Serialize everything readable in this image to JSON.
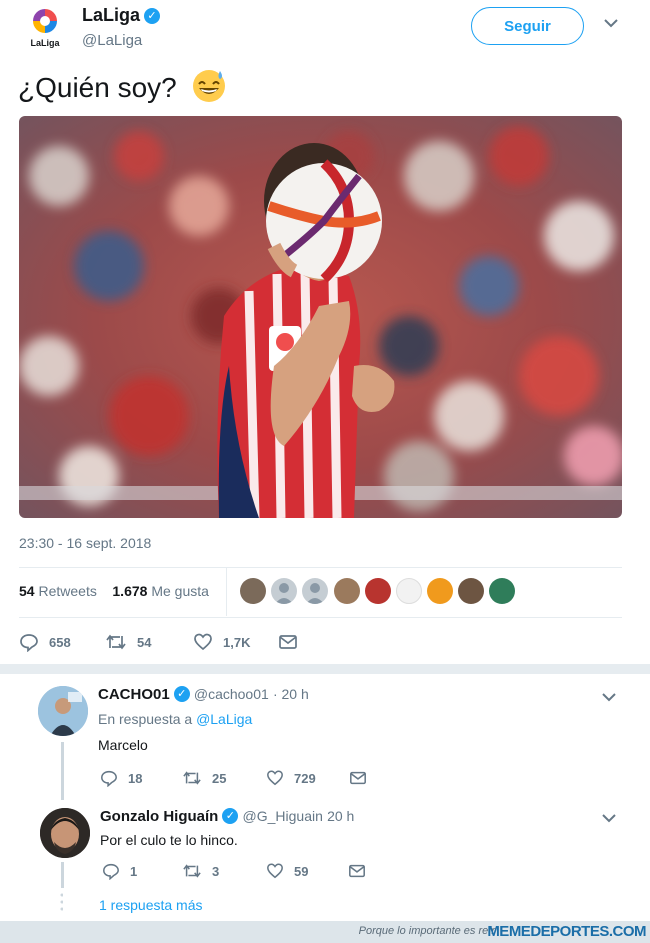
{
  "tweet": {
    "name": "LaLiga",
    "handle": "@LaLiga",
    "logo_text": "LaLiga",
    "follow_label": "Seguir",
    "text": "¿Quién soy?",
    "timestamp": "23:30 - 16 sept. 2018",
    "retweets_count": "54",
    "retweets_label": "Retweets",
    "likes_count": "1.678",
    "likes_label": "Me gusta",
    "actions": {
      "replies": "658",
      "retweets": "54",
      "likes": "1,7K"
    }
  },
  "replies": [
    {
      "name": "CACHO01",
      "handle": "@cachoo01",
      "time": "· 20 h",
      "reply_to_label": "En respuesta a",
      "reply_to": "@LaLiga",
      "text": "Marcelo",
      "replies": "18",
      "retweets": "25",
      "likes": "729"
    },
    {
      "name": "Gonzalo Higuaín",
      "handle": "@G_Higuain",
      "time": "20 h",
      "text": "Por el culo te lo hinco.",
      "replies": "1",
      "retweets": "3",
      "likes": "59"
    }
  ],
  "more_replies": "1 respuesta más",
  "footer": {
    "tagline": "Porque lo importante es reír",
    "brand": "MEMEDEPORTES.COM"
  },
  "colors": {
    "accent": "#1da1f2",
    "text": "#14171a",
    "muted": "#657786",
    "like": "#e0245e"
  },
  "icons": [
    "verified-badge-icon",
    "chevron-down-icon",
    "reply-icon",
    "retweet-icon",
    "heart-icon",
    "message-icon",
    "grinning-sweat-emoji"
  ]
}
